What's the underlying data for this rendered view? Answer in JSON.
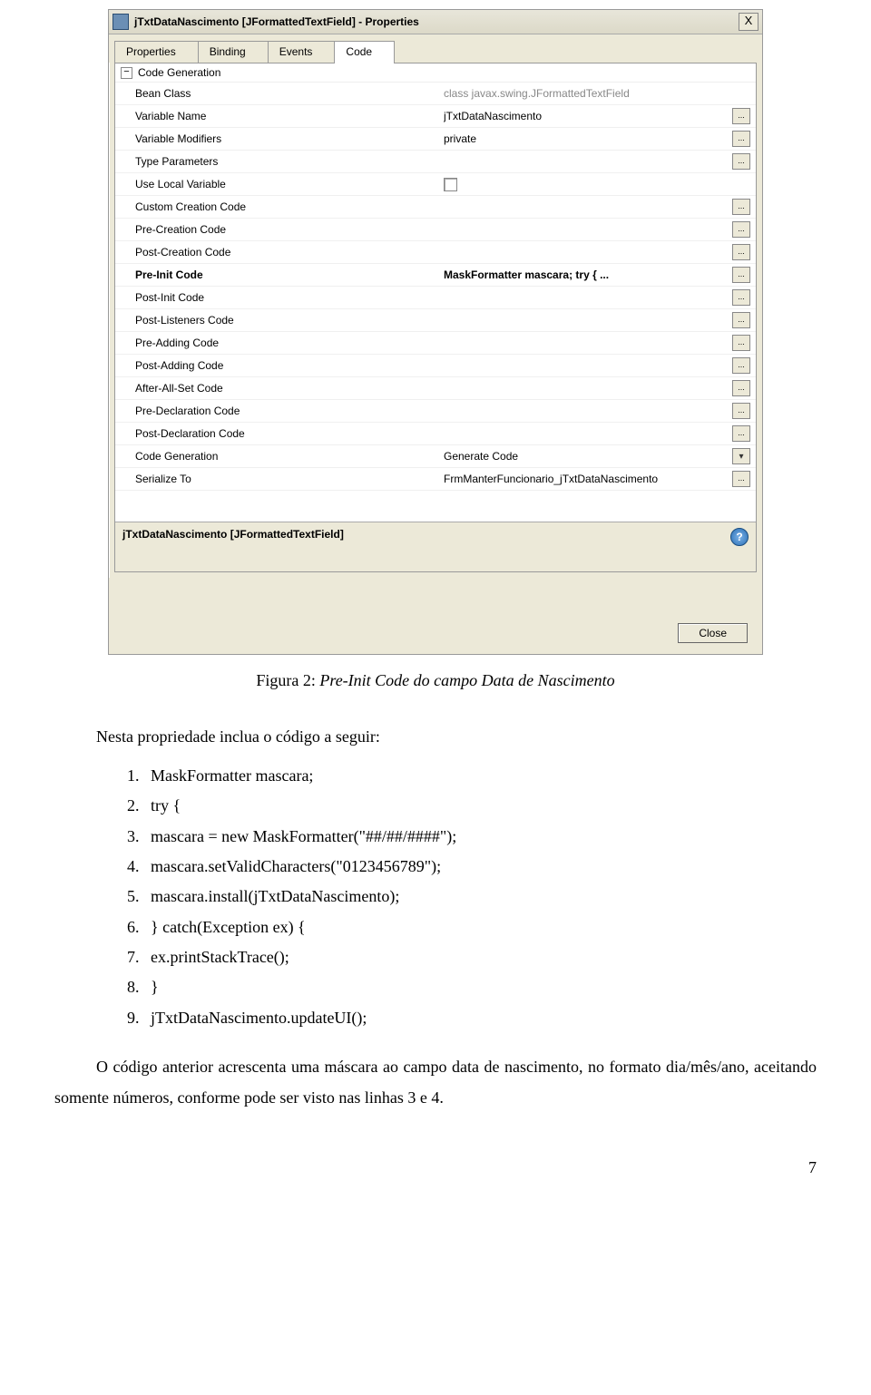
{
  "dialog": {
    "title": "jTxtDataNascimento [JFormattedTextField] - Properties",
    "close_x": "X",
    "tabs": [
      "Properties",
      "Binding",
      "Events",
      "Code"
    ],
    "active_tab": 3,
    "group": "Code Generation",
    "rows": [
      {
        "label": "Bean Class",
        "value": "class javax.swing.JFormattedTextField",
        "disabled": true,
        "btns": []
      },
      {
        "label": "Variable Name",
        "value": "jTxtDataNascimento",
        "btns": [
          "..."
        ]
      },
      {
        "label": "Variable Modifiers",
        "value": "private",
        "btns": [
          "..."
        ]
      },
      {
        "label": "Type Parameters",
        "value": "",
        "btns": [
          "..."
        ]
      },
      {
        "label": "Use Local Variable",
        "value": "",
        "checkbox": true,
        "btns": []
      },
      {
        "label": "Custom Creation Code",
        "value": "",
        "btns": [
          "..."
        ]
      },
      {
        "label": "Pre-Creation Code",
        "value": "",
        "btns": [
          "..."
        ]
      },
      {
        "label": "Post-Creation Code",
        "value": "",
        "btns": [
          "..."
        ]
      },
      {
        "label": "Pre-Init Code",
        "value": "MaskFormatter mascara;            try {    ...",
        "bold": true,
        "btns": [
          "..."
        ]
      },
      {
        "label": "Post-Init Code",
        "value": "",
        "btns": [
          "..."
        ]
      },
      {
        "label": "Post-Listeners Code",
        "value": "",
        "btns": [
          "..."
        ]
      },
      {
        "label": "Pre-Adding Code",
        "value": "",
        "btns": [
          "..."
        ]
      },
      {
        "label": "Post-Adding Code",
        "value": "",
        "btns": [
          "..."
        ]
      },
      {
        "label": "After-All-Set Code",
        "value": "",
        "btns": [
          "..."
        ]
      },
      {
        "label": "Pre-Declaration Code",
        "value": "",
        "btns": [
          "..."
        ]
      },
      {
        "label": "Post-Declaration Code",
        "value": "",
        "btns": [
          "..."
        ]
      },
      {
        "label": "Code Generation",
        "value": "Generate Code",
        "dropdown": true,
        "btns": []
      },
      {
        "label": "Serialize To",
        "value": "FrmManterFuncionario_jTxtDataNascimento",
        "btns": [
          "..."
        ]
      }
    ],
    "desc_title": "jTxtDataNascimento [JFormattedTextField]",
    "close_label": "Close"
  },
  "caption": {
    "prefix": "Figura 2:  ",
    "title": "Pre-Init Code do campo Data de Nascimento"
  },
  "intro": "Nesta propriedade inclua o código a seguir:",
  "code_lines": [
    "MaskFormatter mascara;",
    "try {",
    "mascara = new MaskFormatter(\"##/##/####\");",
    "mascara.setValidCharacters(\"0123456789\");",
    "mascara.install(jTxtDataNascimento);",
    "} catch(Exception ex) {",
    "ex.printStackTrace();",
    "}",
    "jTxtDataNascimento.updateUI();"
  ],
  "paragraph": "O código anterior acrescenta uma máscara ao campo data de nascimento, no formato dia/mês/ano, aceitando somente números, conforme pode ser visto nas linhas 3 e 4.",
  "page_number": "7"
}
